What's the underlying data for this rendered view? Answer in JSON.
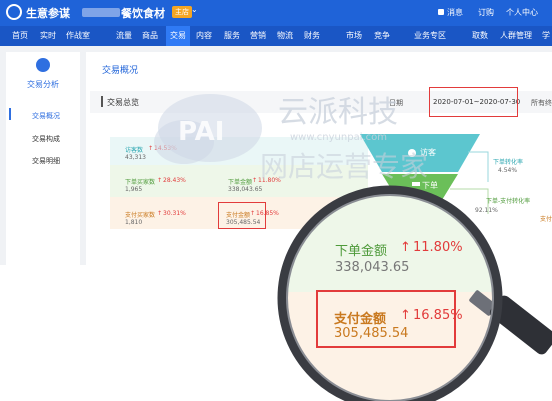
{
  "header": {
    "brand": "生意参谋",
    "store_name": "餐饮食材",
    "store_badge": "主店",
    "message": "消息",
    "order": "订购",
    "personal_center": "个人中心"
  },
  "nav": {
    "items": [
      "首页",
      "实时",
      "作战室",
      "流量",
      "商品",
      "交易",
      "内容",
      "服务",
      "营销",
      "物流",
      "财务",
      "市场",
      "竞争",
      "业务专区",
      "取数",
      "人群管理",
      "学"
    ],
    "active": "交易"
  },
  "sidebar": {
    "title": "交易分析",
    "items": [
      "交易概况",
      "交易构成",
      "交易明细"
    ],
    "active": "交易概况"
  },
  "main": {
    "section_title": "交易概况",
    "summary_title": "交易总览",
    "date_label": "日期",
    "date_range": "2020-07-01~2020-07-30",
    "all_terminal": "所有终"
  },
  "stats": {
    "visitors": {
      "label": "访客数",
      "change": "14.53%",
      "value": "43,313"
    },
    "order_buyers": {
      "label": "下单买家数",
      "change": "28.43%",
      "value": "1,965"
    },
    "order_amount": {
      "label": "下单金额",
      "change": "11.80%",
      "value": "338,043.65"
    },
    "pay_buyers": {
      "label": "支付买家数",
      "change": "30.31%",
      "value": "1,810"
    },
    "pay_amount": {
      "label": "支付金额",
      "change": "16.85%",
      "value": "305,485.54"
    }
  },
  "funnel": {
    "stage_visitors": "访客",
    "stage_order": "下单",
    "rate_order": {
      "label": "下单转化率",
      "value": "4.54%"
    },
    "rate_order_pay": {
      "label": "下单-支付转化率",
      "value": "92.11%"
    },
    "rate_pay_partial": "支付"
  },
  "watermark": {
    "logo": "PAI",
    "text_cn": "云派科技",
    "url": "www.cnyunpai.com",
    "text_cn_2": "网店运营专家"
  },
  "magnifier": {
    "order_amount": {
      "label": "下单金额",
      "change": "11.80%",
      "value": "338,043.65"
    },
    "pay_amount": {
      "label": "支付金额",
      "change": "16.85%",
      "value": "305,485.54"
    }
  },
  "colors": {
    "brand_blue": "#1f63d8",
    "highlight_red": "#e23b3b",
    "up_red": "#e23b3b",
    "funnel_teal": "#5cc6cf",
    "funnel_green": "#6bbf59",
    "funnel_orange": "#f29d38"
  },
  "icons": [
    "logo-icon",
    "message-icon",
    "chevron-down-icon",
    "analysis-icon",
    "user-icon",
    "hammer-icon",
    "up-arrow-icon",
    "magnifier-icon"
  ]
}
